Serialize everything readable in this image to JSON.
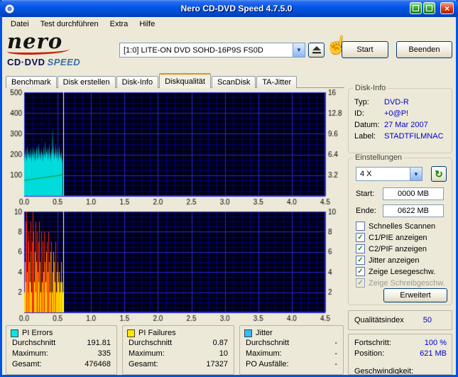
{
  "window": {
    "title": "Nero CD-DVD Speed 4.7.5.0"
  },
  "titlebar_icons": [
    "titlebar-green-icon-1",
    "titlebar-green-icon-2",
    "close-button"
  ],
  "close_glyph": "×",
  "menu": {
    "items": [
      "Datei",
      "Test durchführen",
      "Extra",
      "Hilfe"
    ]
  },
  "logo": {
    "script": "nero",
    "line2_left": "CD·DVD",
    "line2_right": "SPEED"
  },
  "drive": {
    "value": "[1:0]   LITE-ON DVD SOHD-16P9S FS0D"
  },
  "header_buttons": {
    "start": "Start",
    "quit": "Beenden"
  },
  "tabs": [
    {
      "label": "Benchmark",
      "active": false
    },
    {
      "label": "Disk erstellen",
      "active": false
    },
    {
      "label": "Disk-Info",
      "active": false
    },
    {
      "label": "Diskqualität",
      "active": true
    },
    {
      "label": "ScanDisk",
      "active": false
    },
    {
      "label": "TA-Jitter",
      "active": false
    }
  ],
  "disk_info": {
    "title": "Disk-Info",
    "rows": [
      {
        "label": "Typ:",
        "value": "DVD-R"
      },
      {
        "label": "ID:",
        "value": "+0@P!"
      },
      {
        "label": "Datum:",
        "value": "27 Mar 2007"
      },
      {
        "label": "Label:",
        "value": "STADTFILMNAC"
      }
    ]
  },
  "settings": {
    "title": "Einstellungen",
    "speed_value": "4 X",
    "refresh_glyph": "↻",
    "start_label": "Start:",
    "start_value": "0000 MB",
    "end_label": "Ende:",
    "end_value": "0622 MB",
    "checkboxes": [
      {
        "label": "Schnelles Scannen",
        "checked": false,
        "disabled": false
      },
      {
        "label": "C1/PIE anzeigen",
        "checked": true,
        "disabled": false
      },
      {
        "label": "C2/PIF anzeigen",
        "checked": true,
        "disabled": false
      },
      {
        "label": "Jitter anzeigen",
        "checked": true,
        "disabled": false
      },
      {
        "label": "Zeige Lesegeschw.",
        "checked": true,
        "disabled": false
      },
      {
        "label": "Zeige Schreibgeschw.",
        "checked": true,
        "disabled": true
      }
    ],
    "advanced_label": "Erweitert"
  },
  "quality": {
    "label": "Qualitätsindex",
    "value": "50"
  },
  "progress": {
    "rows": [
      {
        "label": "Fortschritt:",
        "value": "100 %"
      },
      {
        "label": "Position:",
        "value": "621 MB"
      },
      {
        "label": "Geschwindigkeit:",
        "value": ""
      }
    ]
  },
  "stats": [
    {
      "legend_color": "#00e8e8",
      "title": "PI Errors",
      "rows": [
        {
          "label": "Durchschnitt",
          "value": "191.81"
        },
        {
          "label": "Maximum:",
          "value": "335"
        },
        {
          "label": "Gesamt:",
          "value": "476468"
        }
      ]
    },
    {
      "legend_color": "#ffe800",
      "title": "PI Failures",
      "rows": [
        {
          "label": "Durchschnitt",
          "value": "0.87"
        },
        {
          "label": "Maximum:",
          "value": "10"
        },
        {
          "label": "Gesamt:",
          "value": "17327"
        }
      ]
    },
    {
      "legend_color": "#33bbff",
      "title": "Jitter",
      "rows": [
        {
          "label": "Durchschnitt",
          "value": "-"
        },
        {
          "label": "Maximum:",
          "value": "-"
        },
        {
          "label": "PO Ausfälle:",
          "value": "-"
        }
      ]
    }
  ],
  "chart_data": [
    {
      "type": "area",
      "title": "PI Errors scan",
      "x_min": 0,
      "x_max": 4.5,
      "x_ticks": [
        "0.0",
        "0.5",
        "1.0",
        "1.5",
        "2.0",
        "2.5",
        "3.0",
        "3.5",
        "4.0",
        "4.5"
      ],
      "y_left": {
        "min": 0,
        "max": 500,
        "ticks": [
          500,
          400,
          300,
          200,
          100
        ]
      },
      "y_right": {
        "min": 0,
        "max": 16,
        "ticks": [
          "16",
          "12.8",
          "9.6",
          "6.4",
          "3.2"
        ]
      },
      "grid": {
        "x_major": 0.5,
        "x_minor": 0.125,
        "y_major": 100,
        "y_minor": 25
      },
      "cursor_x": 0.585,
      "series": [
        {
          "name": "PI Errors",
          "kind": "area",
          "axis": "left",
          "color": "#00dcdc",
          "data_x_start": 0,
          "data_x_end": 0.575,
          "values": [
            155,
            210,
            178,
            232,
            190,
            168,
            245,
            203,
            186,
            221,
            174,
            199,
            236,
            158,
            212,
            189,
            247,
            176,
            205,
            228,
            163,
            194,
            218,
            241,
            172,
            188,
            256,
            209,
            181,
            224,
            167,
            235,
            192,
            214,
            159,
            243,
            201,
            186,
            270,
            178,
            222,
            196,
            240,
            169,
            208,
            251,
            183,
            217,
            162,
            229,
            198,
            335,
            187,
            243,
            171,
            215,
            190,
            258,
            176,
            204,
            233,
            165,
            196,
            248,
            182,
            210,
            174,
            226,
            158,
            188
          ]
        },
        {
          "name": "Lesegeschwindigkeit",
          "kind": "line",
          "axis": "right",
          "color": "#00a651",
          "x": [
            0,
            0.1,
            0.2,
            0.3,
            0.4,
            0.5,
            0.575
          ],
          "y": [
            2.4,
            2.55,
            2.7,
            2.85,
            3.0,
            3.15,
            3.3
          ]
        }
      ]
    },
    {
      "type": "bar",
      "title": "PI Failures scan",
      "x_min": 0,
      "x_max": 4.5,
      "x_ticks": [
        "0.0",
        "0.5",
        "1.0",
        "1.5",
        "2.0",
        "2.5",
        "3.0",
        "3.5",
        "4.0",
        "4.5"
      ],
      "y_left": {
        "min": 0,
        "max": 10,
        "ticks": [
          10,
          8,
          6,
          4,
          2
        ]
      },
      "y_right": {
        "min": 0,
        "max": 10,
        "ticks": [
          "10",
          "8",
          "6",
          "4",
          "2"
        ]
      },
      "grid": {
        "x_major": 0.5,
        "x_minor": 0.125,
        "y_major": 2,
        "y_minor": 0.5
      },
      "cursor_x": 0.585,
      "series": [
        {
          "name": "PI Failures",
          "kind": "bars",
          "axis": "left",
          "data_x_start": 0,
          "data_x_end": 0.575,
          "color_thresholds": [
            {
              "max": 3,
              "color": "#ffe800"
            },
            {
              "max": 6,
              "color": "#ff9c00"
            },
            {
              "max": 10,
              "color": "#ff2400"
            }
          ],
          "values": [
            2,
            5,
            9,
            3,
            10,
            4,
            7,
            2,
            8,
            5,
            3,
            9,
            6,
            2,
            7,
            10,
            4,
            8,
            3,
            6,
            9,
            2,
            5,
            8,
            4,
            7,
            3,
            9,
            5,
            2,
            6,
            8,
            3,
            7,
            4,
            2,
            8,
            5,
            3,
            6,
            2,
            7,
            4,
            8,
            3,
            5,
            2,
            6,
            3,
            7,
            2,
            4,
            6,
            2,
            5,
            3,
            7,
            2,
            4,
            2,
            5,
            3,
            2,
            4,
            2,
            3,
            5,
            2,
            3,
            2
          ]
        }
      ]
    }
  ]
}
